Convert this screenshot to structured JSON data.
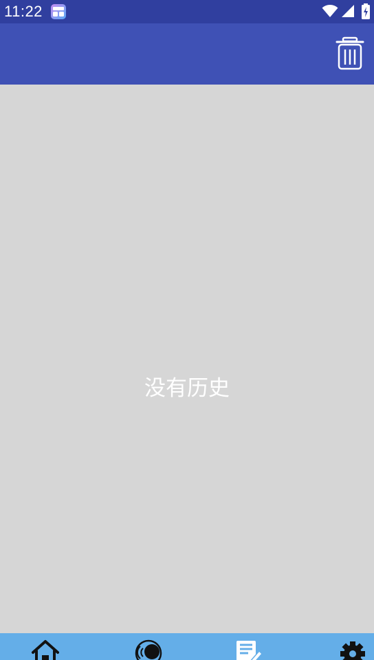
{
  "status_bar": {
    "time": "11:22"
  },
  "app_bar": {
    "delete_icon": "trash-icon"
  },
  "content": {
    "empty_message": "没有历史"
  },
  "bottom_nav": {
    "items": [
      {
        "icon": "home-icon"
      },
      {
        "icon": "voice-icon"
      },
      {
        "icon": "notes-icon"
      },
      {
        "icon": "settings-icon"
      }
    ]
  },
  "colors": {
    "status_bar": "#303f9f",
    "app_bar": "#3f51b5",
    "background": "#d6d6d6",
    "bottom_nav": "#64aee8"
  }
}
